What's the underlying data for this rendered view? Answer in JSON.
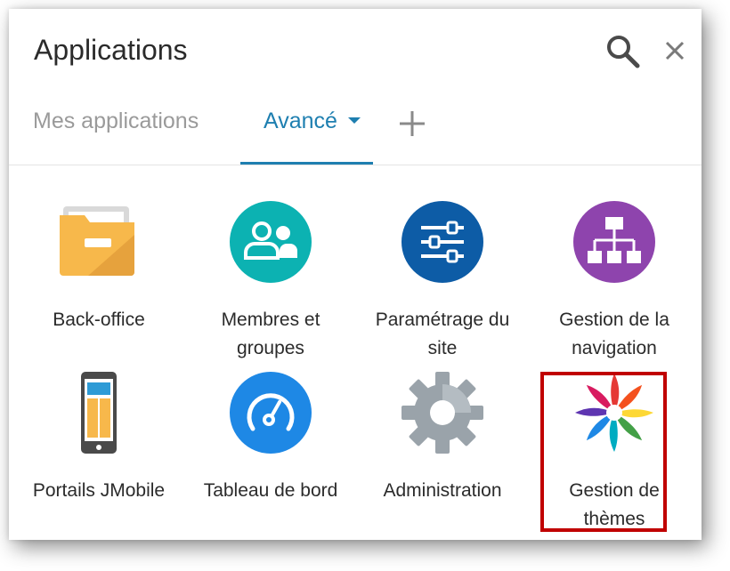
{
  "header": {
    "title": "Applications",
    "search_icon": "search-icon",
    "close_icon": "close-icon"
  },
  "tabs": [
    {
      "label": "Mes applications",
      "active": false
    },
    {
      "label": "Avancé",
      "active": true,
      "has_dropdown": true
    }
  ],
  "add_tab_icon": "plus-icon",
  "apps": [
    {
      "label_line1": "Back-office",
      "label_line2": "",
      "icon": "folder-icon"
    },
    {
      "label_line1": "Membres et",
      "label_line2": "groupes",
      "icon": "users-icon"
    },
    {
      "label_line1": "Paramétrage du",
      "label_line2": "site",
      "icon": "sliders-icon"
    },
    {
      "label_line1": "Gestion de la",
      "label_line2": "navigation",
      "icon": "sitemap-icon"
    },
    {
      "label_line1": "Portails JMobile",
      "label_line2": "",
      "icon": "smartphone-icon"
    },
    {
      "label_line1": "Tableau de bord",
      "label_line2": "",
      "icon": "dashboard-icon"
    },
    {
      "label_line1": "Administration",
      "label_line2": "",
      "icon": "gear-icon"
    },
    {
      "label_line1": "Gestion de",
      "label_line2": "thèmes",
      "icon": "pinwheel-icon",
      "highlighted": true
    }
  ],
  "colors": {
    "accent": "#1e7fb0",
    "highlight_border": "#c00000",
    "inactive_tab": "#9a9a9a"
  }
}
